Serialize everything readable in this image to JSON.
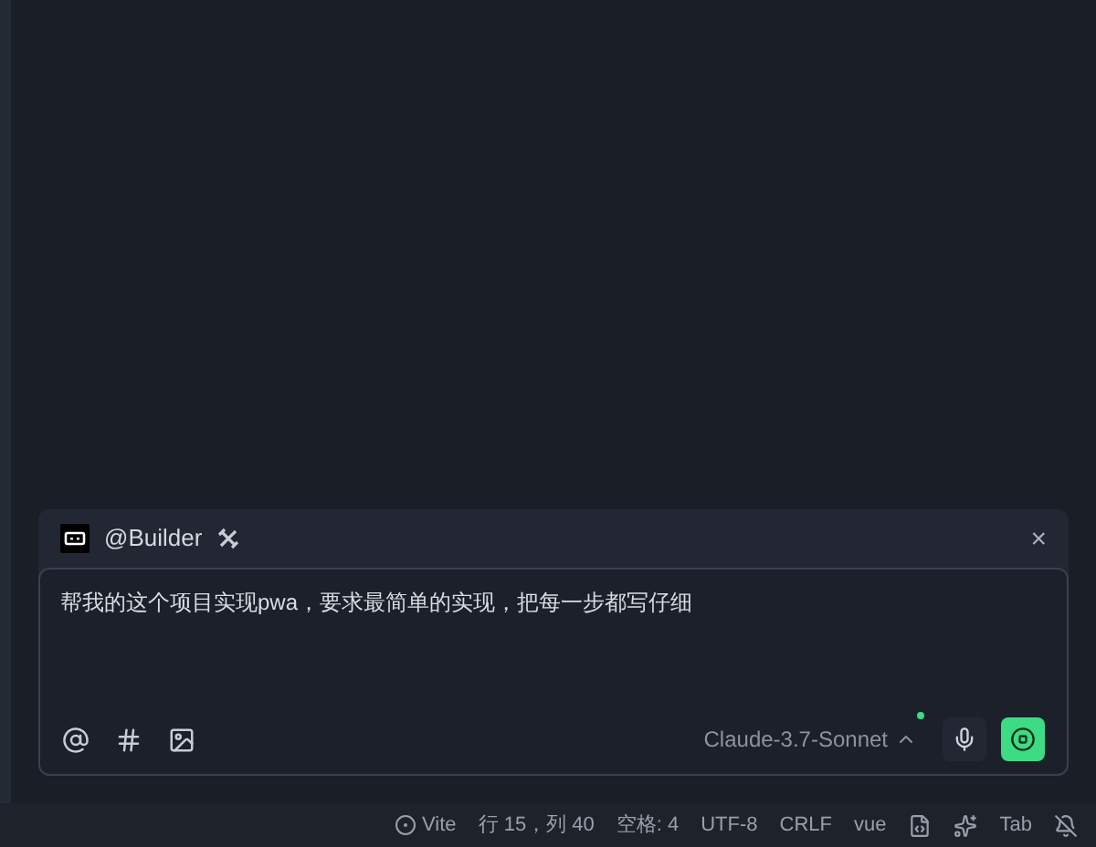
{
  "chat": {
    "agent": "@Builder",
    "close": "×",
    "message": "帮我的这个项目实现pwa，要求最简单的实现，把每一步都写仔细",
    "model": "Claude-3.7-Sonnet"
  },
  "status_bar": {
    "items": [
      {
        "kind": "run",
        "text": "Vite"
      },
      {
        "kind": "text",
        "text": "行 15，列 40"
      },
      {
        "kind": "text",
        "text": "空格: 4"
      },
      {
        "kind": "text",
        "text": "UTF-8"
      },
      {
        "kind": "text",
        "text": "CRLF"
      },
      {
        "kind": "text",
        "text": "vue"
      },
      {
        "kind": "file-icon"
      },
      {
        "kind": "sparkle-icon"
      },
      {
        "kind": "text",
        "text": "Tab"
      },
      {
        "kind": "bell-icon"
      }
    ]
  }
}
